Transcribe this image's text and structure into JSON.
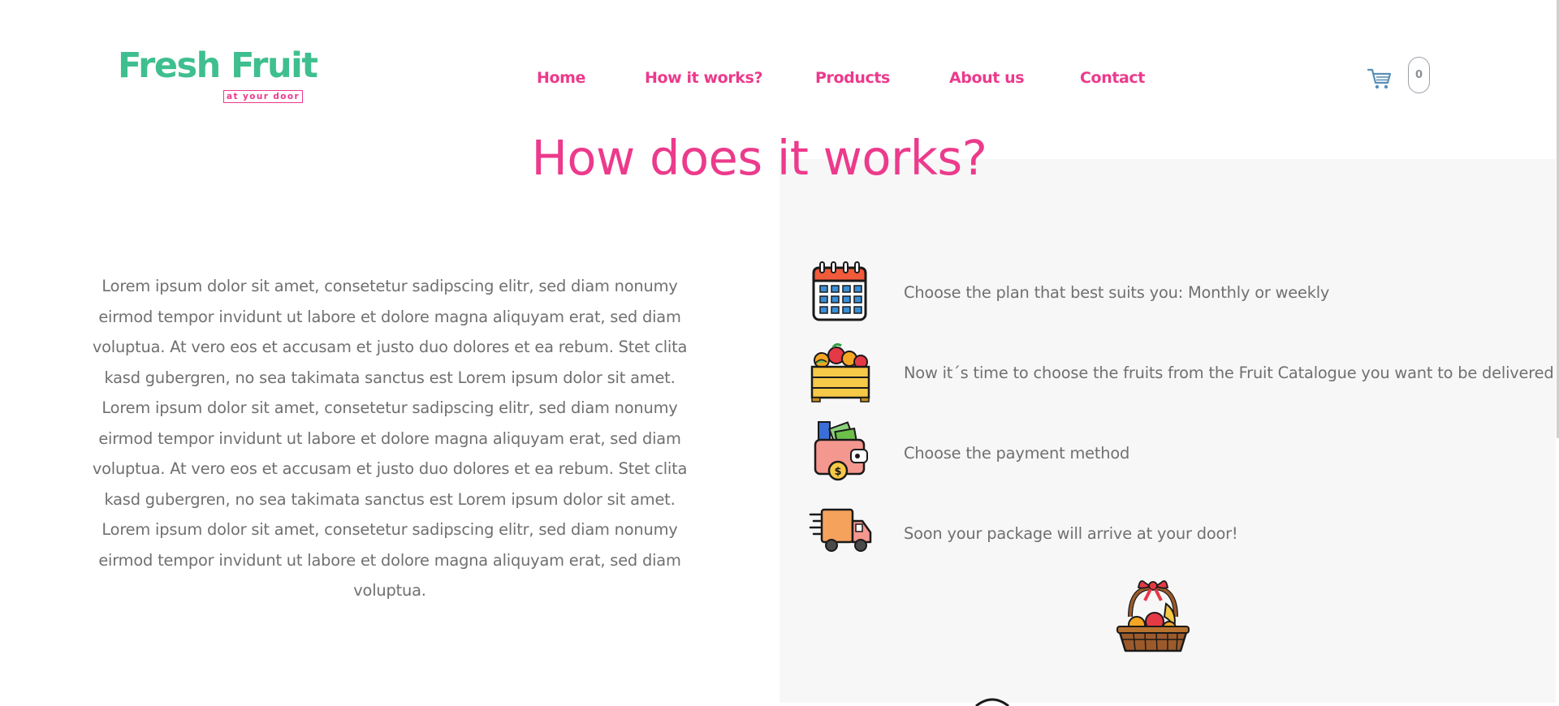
{
  "brand": {
    "name": "Fresh Fruit",
    "tagline": "at your door",
    "primary_color": "#3fbf8f",
    "accent_color": "#ec3a8c"
  },
  "nav": {
    "items": [
      {
        "label": "Home"
      },
      {
        "label": "How it works?"
      },
      {
        "label": "Products"
      },
      {
        "label": "About us"
      },
      {
        "label": "Contact"
      }
    ]
  },
  "cart": {
    "icon": "shopping-cart-icon",
    "count": "0"
  },
  "section": {
    "title": "How does it works?",
    "body": "Lorem ipsum dolor sit amet, consetetur sadipscing elitr, sed diam nonumy eirmod tempor invidunt ut labore et dolore magna aliquyam erat, sed diam voluptua. At vero eos et accusam et justo duo dolores et ea rebum. Stet clita kasd gubergren, no sea takimata sanctus est Lorem ipsum dolor sit amet. Lorem ipsum dolor sit amet, consetetur sadipscing elitr, sed diam nonumy eirmod tempor invidunt ut labore et dolore magna aliquyam erat, sed diam voluptua. At vero eos et accusam et justo duo dolores et ea rebum. Stet clita kasd gubergren, no sea takimata sanctus est Lorem ipsum dolor sit amet. Lorem ipsum dolor sit amet, consetetur sadipscing elitr, sed diam nonumy eirmod tempor invidunt ut labore et dolore magna aliquyam erat, sed diam voluptua."
  },
  "steps": [
    {
      "icon": "calendar-icon",
      "text": "Choose the plan that best suits you: Monthly or weekly"
    },
    {
      "icon": "fruit-crate-icon",
      "text": "Now it´s time to choose the fruits from the Fruit Catalogue you want to be delivered"
    },
    {
      "icon": "wallet-icon",
      "text": "Choose the payment method"
    },
    {
      "icon": "delivery-truck-icon",
      "text": "Soon your package will arrive at your door!"
    }
  ],
  "decor": {
    "basket_icon": "fruit-basket-icon"
  }
}
